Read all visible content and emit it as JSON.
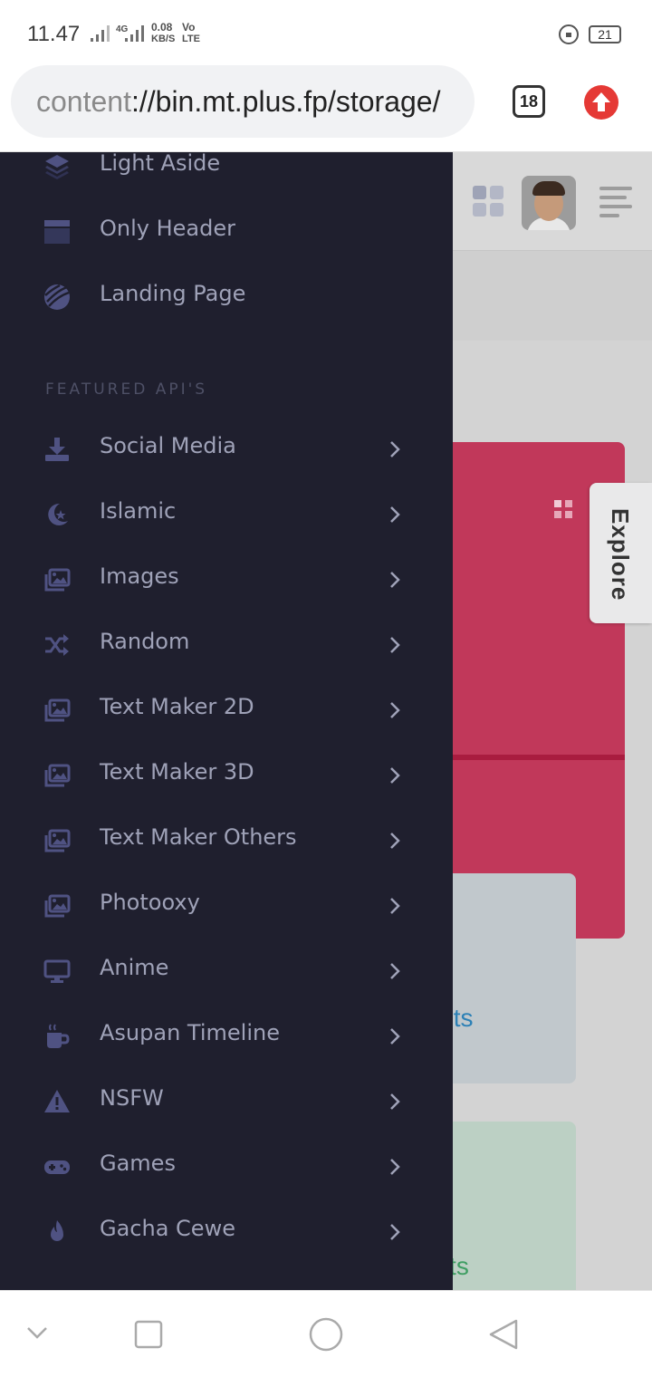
{
  "status_bar": {
    "time": "11.47",
    "network_type": "4G",
    "speed": "0.08",
    "speed_unit": "KB/S",
    "volte_top": "Vo",
    "volte_bottom": "LTE",
    "battery": "21"
  },
  "browser": {
    "url_scheme": "content",
    "url_rest": "://bin.mt.plus.fp/storage/",
    "tab_count": "18"
  },
  "sidebar": {
    "top_items": [
      {
        "label": "Light Aside",
        "icon": "layers-icon"
      },
      {
        "label": "Only Header",
        "icon": "header-layout-icon"
      },
      {
        "label": "Landing Page",
        "icon": "globe-icon"
      }
    ],
    "section_title": "FEATURED API'S",
    "items": [
      {
        "label": "Social Media",
        "icon": "download-icon"
      },
      {
        "label": "Islamic",
        "icon": "moon-star-icon"
      },
      {
        "label": "Images",
        "icon": "images-icon"
      },
      {
        "label": "Random",
        "icon": "shuffle-icon"
      },
      {
        "label": "Text Maker 2D",
        "icon": "images-icon"
      },
      {
        "label": "Text Maker 3D",
        "icon": "images-icon"
      },
      {
        "label": "Text Maker Others",
        "icon": "images-icon"
      },
      {
        "label": "Photooxy",
        "icon": "images-icon"
      },
      {
        "label": "Anime",
        "icon": "monitor-icon"
      },
      {
        "label": "Asupan Timeline",
        "icon": "coffee-icon"
      },
      {
        "label": "NSFW",
        "icon": "warning-icon"
      },
      {
        "label": "Games",
        "icon": "gamepad-icon"
      },
      {
        "label": "Gacha Cewe",
        "icon": "fire-icon"
      }
    ]
  },
  "background_page": {
    "card_projects_text": "rojects",
    "card_reports_text": "eports",
    "explore_label": "Explore"
  },
  "colors": {
    "sidebar_bg": "#1f1f2e",
    "sidebar_text": "#9fa2b8",
    "icon": "#4f5282",
    "accent_red": "#c1385a"
  }
}
